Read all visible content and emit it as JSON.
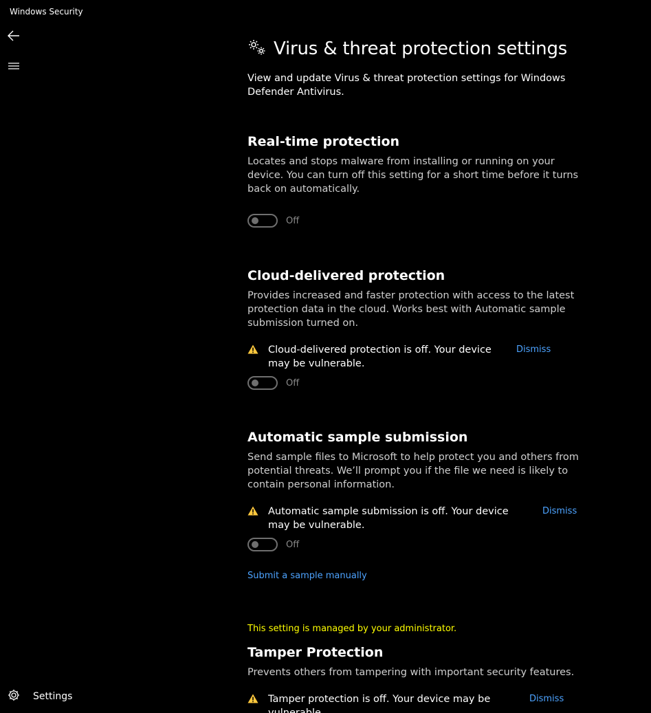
{
  "window": {
    "title": "Windows Security"
  },
  "nav": {
    "back_icon": "back-arrow-icon",
    "menu_icon": "hamburger-menu-icon",
    "settings_icon": "gear-icon",
    "settings_label": "Settings"
  },
  "page": {
    "title_icon": "gears-icon",
    "title": "Virus & threat protection settings",
    "description": "View and update Virus & threat protection settings for Windows Defender Antivirus."
  },
  "sections": {
    "realtime": {
      "title": "Real-time protection",
      "description": "Locates and stops malware from installing or running on your device. You can turn off this setting for a short time before it turns back on automatically.",
      "toggle_state": "Off"
    },
    "cloud": {
      "title": "Cloud-delivered protection",
      "description": "Provides increased and faster protection with access to the latest protection data in the cloud. Works best with Automatic sample submission turned on.",
      "warning": "Cloud-delivered protection is off. Your device may be vulnerable.",
      "dismiss_label": "Dismiss",
      "toggle_state": "Off"
    },
    "sample": {
      "title": "Automatic sample submission",
      "description": "Send sample files to Microsoft to help protect you and others from potential threats. We’ll prompt you if the file we need is likely to contain personal information.",
      "warning": "Automatic sample submission is off. Your device may be vulnerable.",
      "dismiss_label": "Dismiss",
      "toggle_state": "Off",
      "link_label": "Submit a sample manually"
    },
    "tamper": {
      "admin_note": "This setting is managed by your administrator.",
      "title": "Tamper Protection",
      "description": "Prevents others from tampering with important security features.",
      "warning": "Tamper protection is off. Your device may be vulnerable.",
      "dismiss_label": "Dismiss"
    }
  },
  "colors": {
    "background": "#000000",
    "link": "#4da3ff",
    "warning_icon": "#ffc83d",
    "admin_note": "#ffff00",
    "toggle_off": "#6f6f6f"
  }
}
